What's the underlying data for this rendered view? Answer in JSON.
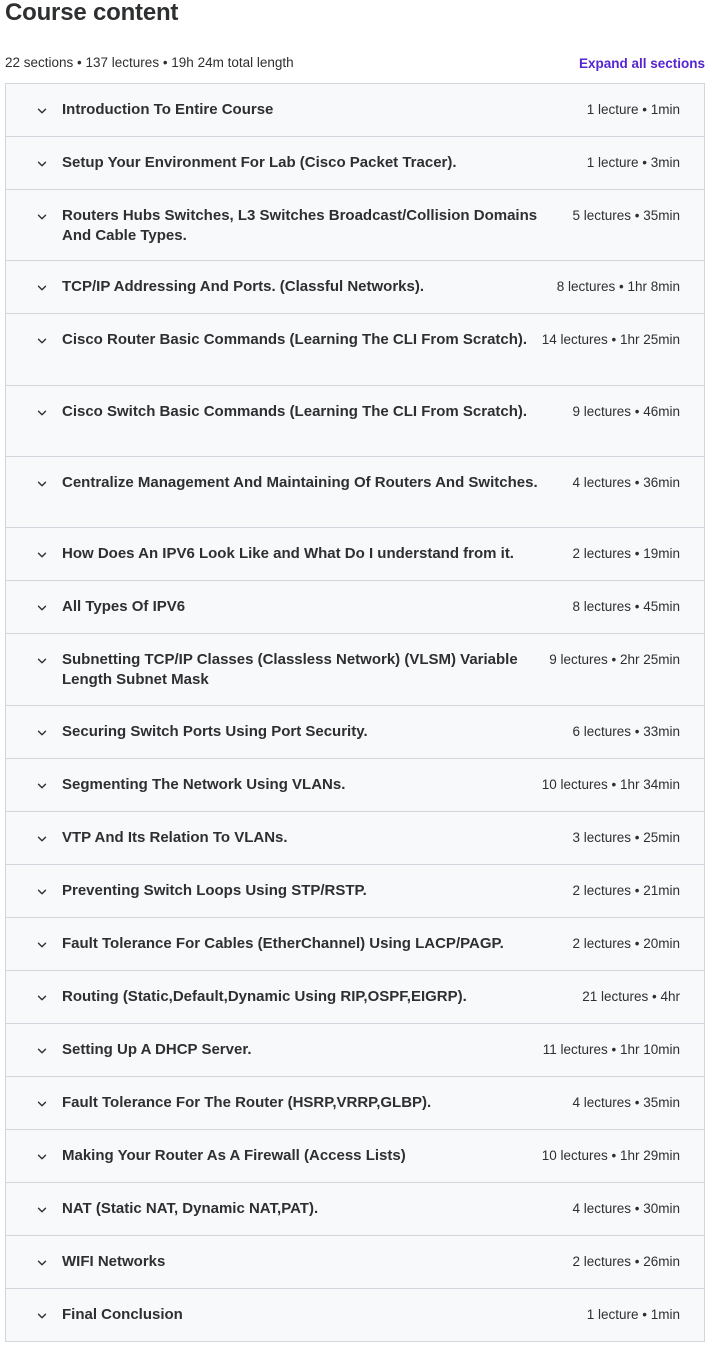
{
  "header": {
    "title": "Course content",
    "summary": "22 sections • 137 lectures • 19h 24m total length",
    "expand_all_label": "Expand all sections"
  },
  "icons": {
    "section_toggle": "chevron-down-icon"
  },
  "colors": {
    "accent": "#5624d0",
    "text": "#2d2f31",
    "section_bg": "#f7f9fa",
    "border": "#d1d7dc"
  },
  "sections": [
    {
      "title": "Introduction To Entire Course",
      "meta": "1 lecture • 1min"
    },
    {
      "title": "Setup Your Environment For Lab (Cisco Packet Tracer).",
      "meta": "1 lecture • 3min"
    },
    {
      "title": "Routers Hubs Switches, L3 Switches Broadcast/Collision Domains And Cable Types.",
      "meta": "5 lectures • 35min"
    },
    {
      "title": "TCP/IP Addressing And Ports. (Classful Networks).",
      "meta": "8 lectures • 1hr 8min"
    },
    {
      "title": "Cisco Router Basic Commands (Learning The CLI From Scratch).",
      "meta": "14 lectures • 1hr 25min"
    },
    {
      "title": "Cisco Switch Basic Commands (Learning The CLI From Scratch).",
      "meta": "9 lectures • 46min"
    },
    {
      "title": "Centralize Management And Maintaining Of Routers And Switches.",
      "meta": "4 lectures • 36min"
    },
    {
      "title": "How Does An IPV6 Look Like and What Do I understand from it.",
      "meta": "2 lectures • 19min"
    },
    {
      "title": "All Types Of IPV6",
      "meta": "8 lectures • 45min"
    },
    {
      "title": "Subnetting TCP/IP Classes (Classless Network) (VLSM) Variable Length Subnet Mask",
      "meta": "9 lectures • 2hr 25min"
    },
    {
      "title": "Securing Switch Ports Using Port Security.",
      "meta": "6 lectures • 33min"
    },
    {
      "title": "Segmenting The Network Using VLANs.",
      "meta": "10 lectures • 1hr 34min"
    },
    {
      "title": "VTP And Its Relation To VLANs.",
      "meta": "3 lectures • 25min"
    },
    {
      "title": "Preventing Switch Loops Using STP/RSTP.",
      "meta": "2 lectures • 21min"
    },
    {
      "title": "Fault Tolerance For Cables (EtherChannel) Using LACP/PAGP.",
      "meta": "2 lectures • 20min"
    },
    {
      "title": "Routing (Static,Default,Dynamic Using RIP,OSPF,EIGRP).",
      "meta": "21 lectures • 4hr"
    },
    {
      "title": "Setting Up A DHCP Server.",
      "meta": "11 lectures • 1hr 10min"
    },
    {
      "title": "Fault Tolerance For The Router (HSRP,VRRP,GLBP).",
      "meta": "4 lectures • 35min"
    },
    {
      "title": "Making Your Router As A Firewall (Access Lists)",
      "meta": "10 lectures • 1hr 29min"
    },
    {
      "title": "NAT (Static NAT, Dynamic NAT,PAT).",
      "meta": "4 lectures • 30min"
    },
    {
      "title": "WIFI Networks",
      "meta": "2 lectures • 26min"
    },
    {
      "title": "Final Conclusion",
      "meta": "1 lecture • 1min"
    }
  ]
}
